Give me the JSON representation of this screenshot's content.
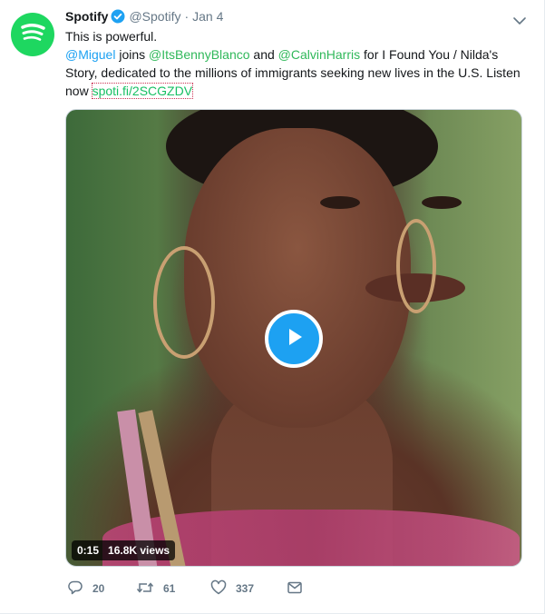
{
  "tweet": {
    "name": "Spotify",
    "handle": "@Spotify",
    "separator": "·",
    "time": "Jan 4",
    "line1": "This is powerful.",
    "mention1": "@Miguel",
    "text_a": " joins ",
    "mention2": "@ItsBennyBlanco",
    "text_b": " and ",
    "mention3": "@CalvinHarris",
    "text_c": " for I Found You / Nilda's Story, dedicated to the millions of immigrants seeking new lives in the U.S. Listen now ",
    "link": "spoti.fi/2SCGZDV"
  },
  "video": {
    "duration": "0:15",
    "views": "16.8K views"
  },
  "actions": {
    "replies": "20",
    "retweets": "61",
    "likes": "337"
  },
  "icons": [
    "spotify-logo-icon",
    "verified-icon",
    "chevron-down-icon",
    "play-icon",
    "reply-icon",
    "retweet-icon",
    "like-icon",
    "message-icon"
  ],
  "colors": {
    "spotify_green": "#1ed760",
    "twitter_blue": "#1da1f2",
    "link_green": "#17bf63",
    "meta_gray": "#657786"
  }
}
